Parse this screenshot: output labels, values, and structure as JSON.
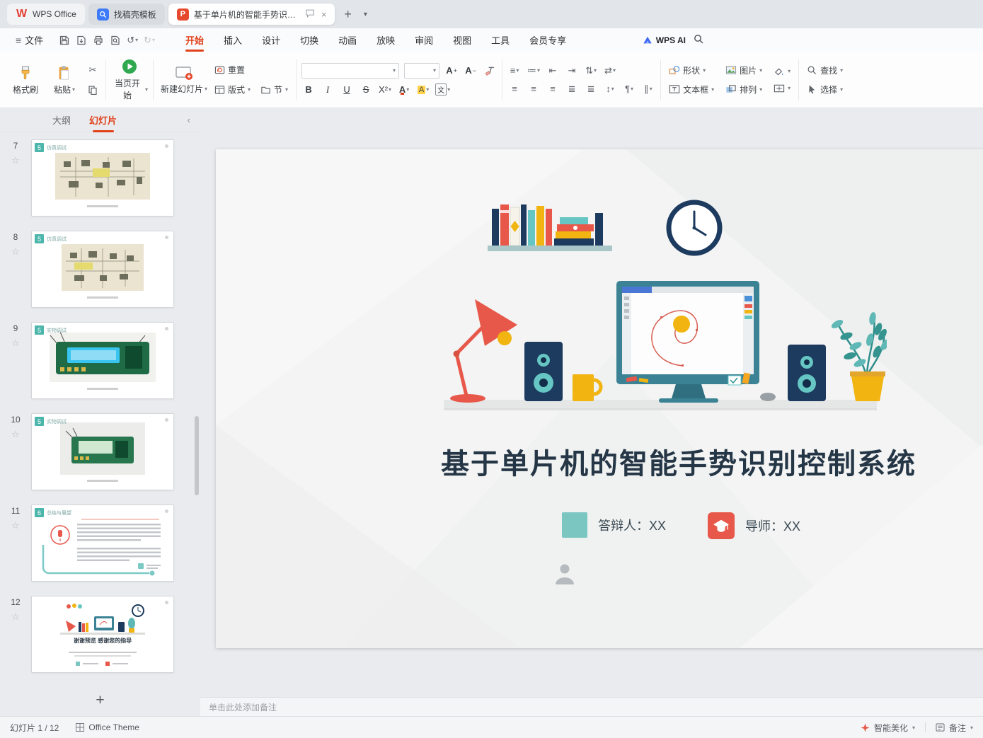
{
  "colors": {
    "wps_red": "#e33e32",
    "accent_orange": "#e0421b",
    "teal": "#66c6c3",
    "navy": "#1d3a5f",
    "yellow": "#f1b410",
    "red": "#e8584a",
    "monitor_teal": "#3a8294",
    "title_text": "#253646"
  },
  "tabbar": {
    "tabs": [
      {
        "label": "WPS Office"
      },
      {
        "label": "找稿壳模板"
      },
      {
        "label": "基于单片机的智能手势识别控制..."
      }
    ]
  },
  "menubar": {
    "file": "文件",
    "items": [
      "开始",
      "插入",
      "设计",
      "切换",
      "动画",
      "放映",
      "审阅",
      "视图",
      "工具",
      "会员专享"
    ],
    "wps_ai": "WPS AI"
  },
  "ribbon": {
    "format_painter": "格式刷",
    "paste": "粘贴",
    "play_current": "当页开始",
    "new_slide": "新建幻灯片",
    "reset": "重置",
    "layout": "版式",
    "section": "节",
    "bold": "B",
    "italic": "I",
    "underline": "U",
    "strikethrough": "S",
    "superscript": "X²",
    "text_tool": "文",
    "shapes": "形状",
    "picture": "图片",
    "textbox": "文本框",
    "arrange": "排列",
    "find": "查找",
    "select": "选择"
  },
  "sidebar": {
    "tab_outline": "大纲",
    "tab_slides": "幻灯片",
    "add_label": "+",
    "slides": [
      {
        "number": "7",
        "badge": "5",
        "title": "仿真调试"
      },
      {
        "number": "8",
        "badge": "5",
        "title": "仿真调试"
      },
      {
        "number": "9",
        "badge": "5",
        "title": "实物调试"
      },
      {
        "number": "10",
        "badge": "5",
        "title": "实物调试"
      },
      {
        "number": "11",
        "badge": "6",
        "title": "总结与展望"
      },
      {
        "number": "12",
        "badge": "",
        "title": "",
        "caption": "谢谢预览 感谢您的指导"
      }
    ]
  },
  "slide": {
    "title": "基于单片机的智能手势识别控制系统",
    "respondent": "答辩人：XX",
    "advisor": "导师：XX"
  },
  "notes": {
    "placeholder": "单击此处添加备注"
  },
  "statusbar": {
    "slide_position": "幻灯片 1 / 12",
    "theme": "Office Theme",
    "beautify": "智能美化",
    "notes_toggle": "备注"
  }
}
